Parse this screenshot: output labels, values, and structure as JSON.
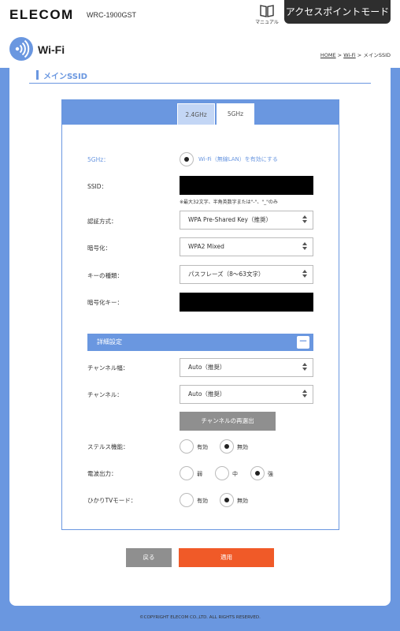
{
  "header": {
    "logo": "ELECOM",
    "model": "WRC-1900GST",
    "manual_label": "マニュアル",
    "ap_mode_label": "アクセスポイントモード"
  },
  "title_bar": {
    "title": "Wi-Fi",
    "breadcrumb": {
      "home": "HOME",
      "sep1": " > ",
      "wifi": "Wi-Fi",
      "sep2": " > ",
      "current": "メインSSID"
    }
  },
  "section": {
    "title": "メインSSID"
  },
  "tabs": [
    {
      "label": "2.4GHz",
      "active": false
    },
    {
      "label": "5GHz",
      "active": true
    }
  ],
  "form": {
    "band": {
      "label": "5GHz：",
      "option": "Wi-Fi（無線LAN）を有効にする",
      "checked": true
    },
    "ssid": {
      "label": "SSID：",
      "note": "※最大32文字、半角英数字または\"-\"、\"_\"のみ"
    },
    "auth": {
      "label": "認証方式：",
      "value": "WPA Pre-Shared Key（推奨）"
    },
    "encryption": {
      "label": "暗号化：",
      "value": "WPA2 Mixed"
    },
    "key_type": {
      "label": "キーの種類：",
      "value": "パスフレーズ（8～63文字）"
    },
    "key": {
      "label": "暗号化キー："
    },
    "advanced": {
      "label": "詳細設定",
      "toggle": "－"
    },
    "channel_width": {
      "label": "チャンネル幅：",
      "value": "Auto（推奨）"
    },
    "channel": {
      "label": "チャンネル：",
      "value": "Auto（推奨）"
    },
    "reselect_button": "チャンネルの再選出",
    "stealth": {
      "label": "ステルス機能：",
      "options": [
        "有効",
        "無効"
      ],
      "selected": 1
    },
    "power": {
      "label": "電波出力：",
      "options": [
        "弱",
        "中",
        "強"
      ],
      "selected": 2
    },
    "hikari_tv": {
      "label": "ひかりTVモード：",
      "options": [
        "有効",
        "無効"
      ],
      "selected": 1
    }
  },
  "buttons": {
    "back": "戻る",
    "apply": "適用"
  },
  "footer": {
    "copyright": "©COPYRIGHT ELECOM CO.,LTD. ALL RIGHTS RESERVED."
  },
  "colors": {
    "accent": "#6a97e0",
    "apply": "#f05a28",
    "gray_button": "#8f8f8f",
    "dark": "#2e2e2e"
  },
  "icons": [
    "manual-book-icon",
    "wifi-icon",
    "chevron-up-down-icon"
  ]
}
